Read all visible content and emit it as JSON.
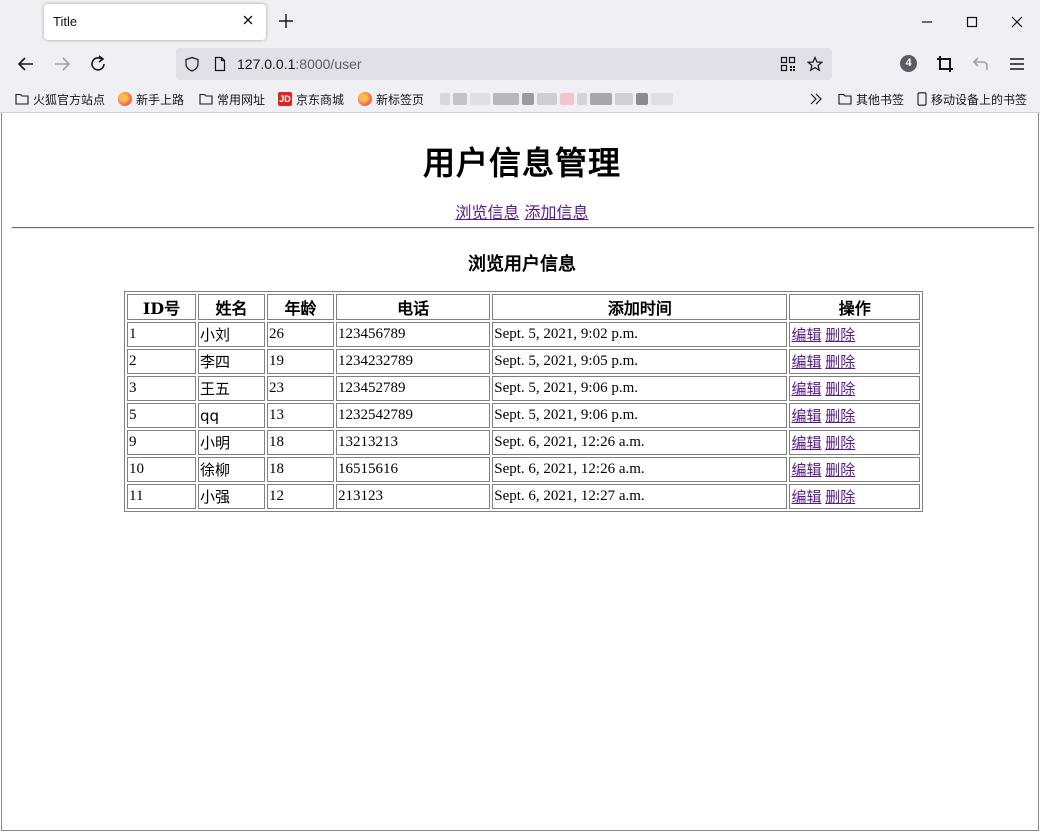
{
  "browser": {
    "tab_title": "Title",
    "url_host": "127.0.0.1",
    "url_rest": ":8000/user",
    "extension_badge": "4",
    "bookmarks": [
      {
        "label": "火狐官方站点",
        "icon": "folder-icon"
      },
      {
        "label": "新手上路",
        "icon": "firefox-icon"
      },
      {
        "label": "常用网址",
        "icon": "folder-icon"
      },
      {
        "label": "京东商城",
        "icon": "jd-icon",
        "icon_text": "JD"
      },
      {
        "label": "新标签页",
        "icon": "firefox-icon"
      }
    ],
    "bookmarks_right": [
      {
        "label": "其他书签",
        "icon": "folder-icon"
      },
      {
        "label": "移动设备上的书签",
        "icon": "mobile-icon"
      }
    ]
  },
  "page": {
    "title": "用户信息管理",
    "nav": {
      "browse": "浏览信息",
      "add": "添加信息"
    },
    "section_title": "浏览用户信息"
  },
  "table": {
    "headers": [
      "ID号",
      "姓名",
      "年龄",
      "电话",
      "添加时间",
      "操作"
    ],
    "rows": [
      {
        "id": "1",
        "name": "小刘",
        "age": "26",
        "phone": "123456789",
        "time": "Sept. 5, 2021, 9:02 p.m.",
        "edit": "编辑",
        "delete": "删除"
      },
      {
        "id": "2",
        "name": "李四",
        "age": "19",
        "phone": "1234232789",
        "time": "Sept. 5, 2021, 9:05 p.m.",
        "edit": "编辑",
        "delete": "删除"
      },
      {
        "id": "3",
        "name": "王五",
        "age": "23",
        "phone": "123452789",
        "time": "Sept. 5, 2021, 9:06 p.m.",
        "edit": "编辑",
        "delete": "删除"
      },
      {
        "id": "5",
        "name": "qq",
        "age": "13",
        "phone": "1232542789",
        "time": "Sept. 5, 2021, 9:06 p.m.",
        "edit": "编辑",
        "delete": "删除"
      },
      {
        "id": "9",
        "name": "小明",
        "age": "18",
        "phone": "13213213",
        "time": "Sept. 6, 2021, 12:26 a.m.",
        "edit": "编辑",
        "delete": "删除"
      },
      {
        "id": "10",
        "name": "徐柳",
        "age": "18",
        "phone": "16515616",
        "time": "Sept. 6, 2021, 12:26 a.m.",
        "edit": "编辑",
        "delete": "删除"
      },
      {
        "id": "11",
        "name": "小强",
        "age": "12",
        "phone": "213123",
        "time": "Sept. 6, 2021, 12:27 a.m.",
        "edit": "编辑",
        "delete": "删除"
      }
    ]
  },
  "colors": {
    "link": "#0000ee",
    "visited_link": "#551a8b",
    "chrome_bg": "#f0f0f4"
  }
}
